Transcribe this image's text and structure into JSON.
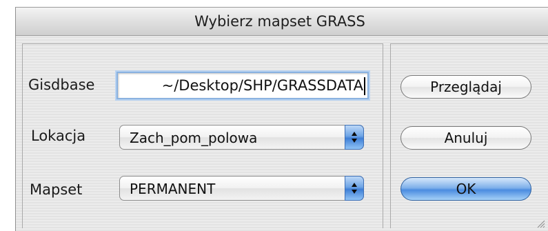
{
  "window": {
    "title": "Wybierz mapset GRASS"
  },
  "form": {
    "gisdbase": {
      "label": "Gisdbase",
      "value": "~/Desktop/SHP/GRASSDATA"
    },
    "lokacja": {
      "label": "Lokacja",
      "selected": "Zach_pom_polowa"
    },
    "mapset": {
      "label": "Mapset",
      "selected": "PERMANENT"
    }
  },
  "buttons": {
    "browse": "Przeglądaj",
    "cancel": "Anuluj",
    "ok": "OK"
  },
  "colors": {
    "focus_ring": "#8ab2e0",
    "accent_blue": "#4b8ce0"
  },
  "icons": {
    "stepper": "up-down-arrows-icon",
    "resize": "resize-grip-icon"
  }
}
